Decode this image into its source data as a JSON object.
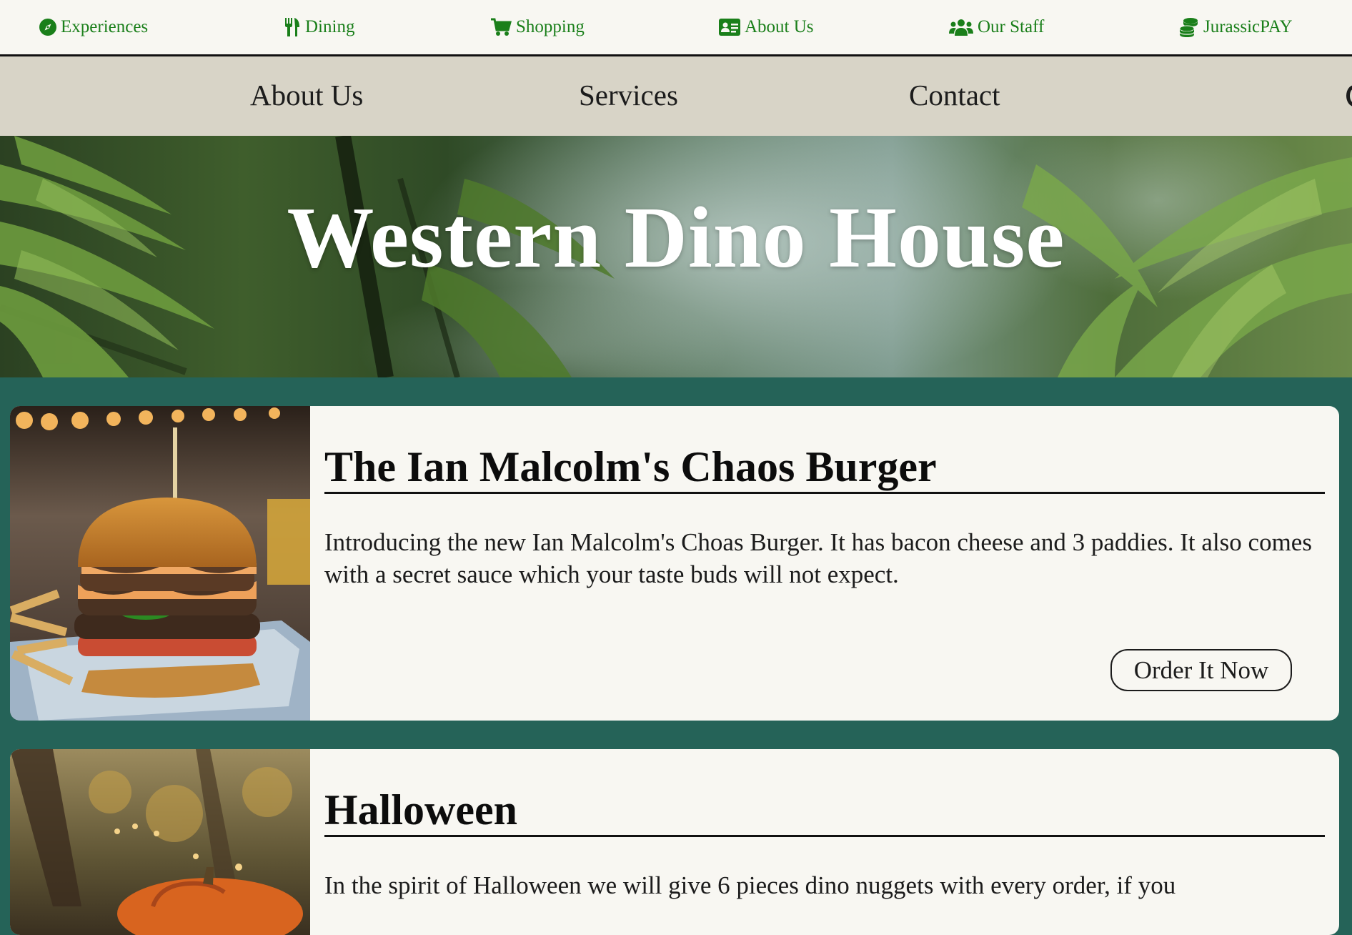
{
  "top_nav": {
    "items": [
      {
        "label": "Experiences",
        "icon": "compass-icon"
      },
      {
        "label": "Dining",
        "icon": "utensils-icon"
      },
      {
        "label": "Shopping",
        "icon": "cart-icon"
      },
      {
        "label": "About Us",
        "icon": "id-card-icon"
      },
      {
        "label": "Our Staff",
        "icon": "users-icon"
      },
      {
        "label": "JurassicPAY",
        "icon": "coins-icon"
      }
    ],
    "color": "#1a7f1a"
  },
  "sub_nav": {
    "items": [
      {
        "label": "About Us"
      },
      {
        "label": "Services"
      },
      {
        "label": "Contact"
      }
    ]
  },
  "hero": {
    "title": "Western Dino House"
  },
  "cards": [
    {
      "title": "The Ian Malcolm's Chaos Burger",
      "text": "Introducing the new Ian Malcolm's Choas Burger. It has bacon cheese and 3 paddies. It also comes with a secret sauce which your taste buds will not expect.",
      "button_label": "Order It Now",
      "image": "burger-photo"
    },
    {
      "title": "Halloween",
      "text": "In the spirit of Halloween we will give 6 pieces dino nuggets with every order, if you",
      "image": "pumpkin-photo"
    }
  ],
  "colors": {
    "page_background": "#256358",
    "card_background": "#f8f7f2",
    "sub_nav_background": "#d8d4c7",
    "nav_link": "#1a7f1a"
  }
}
